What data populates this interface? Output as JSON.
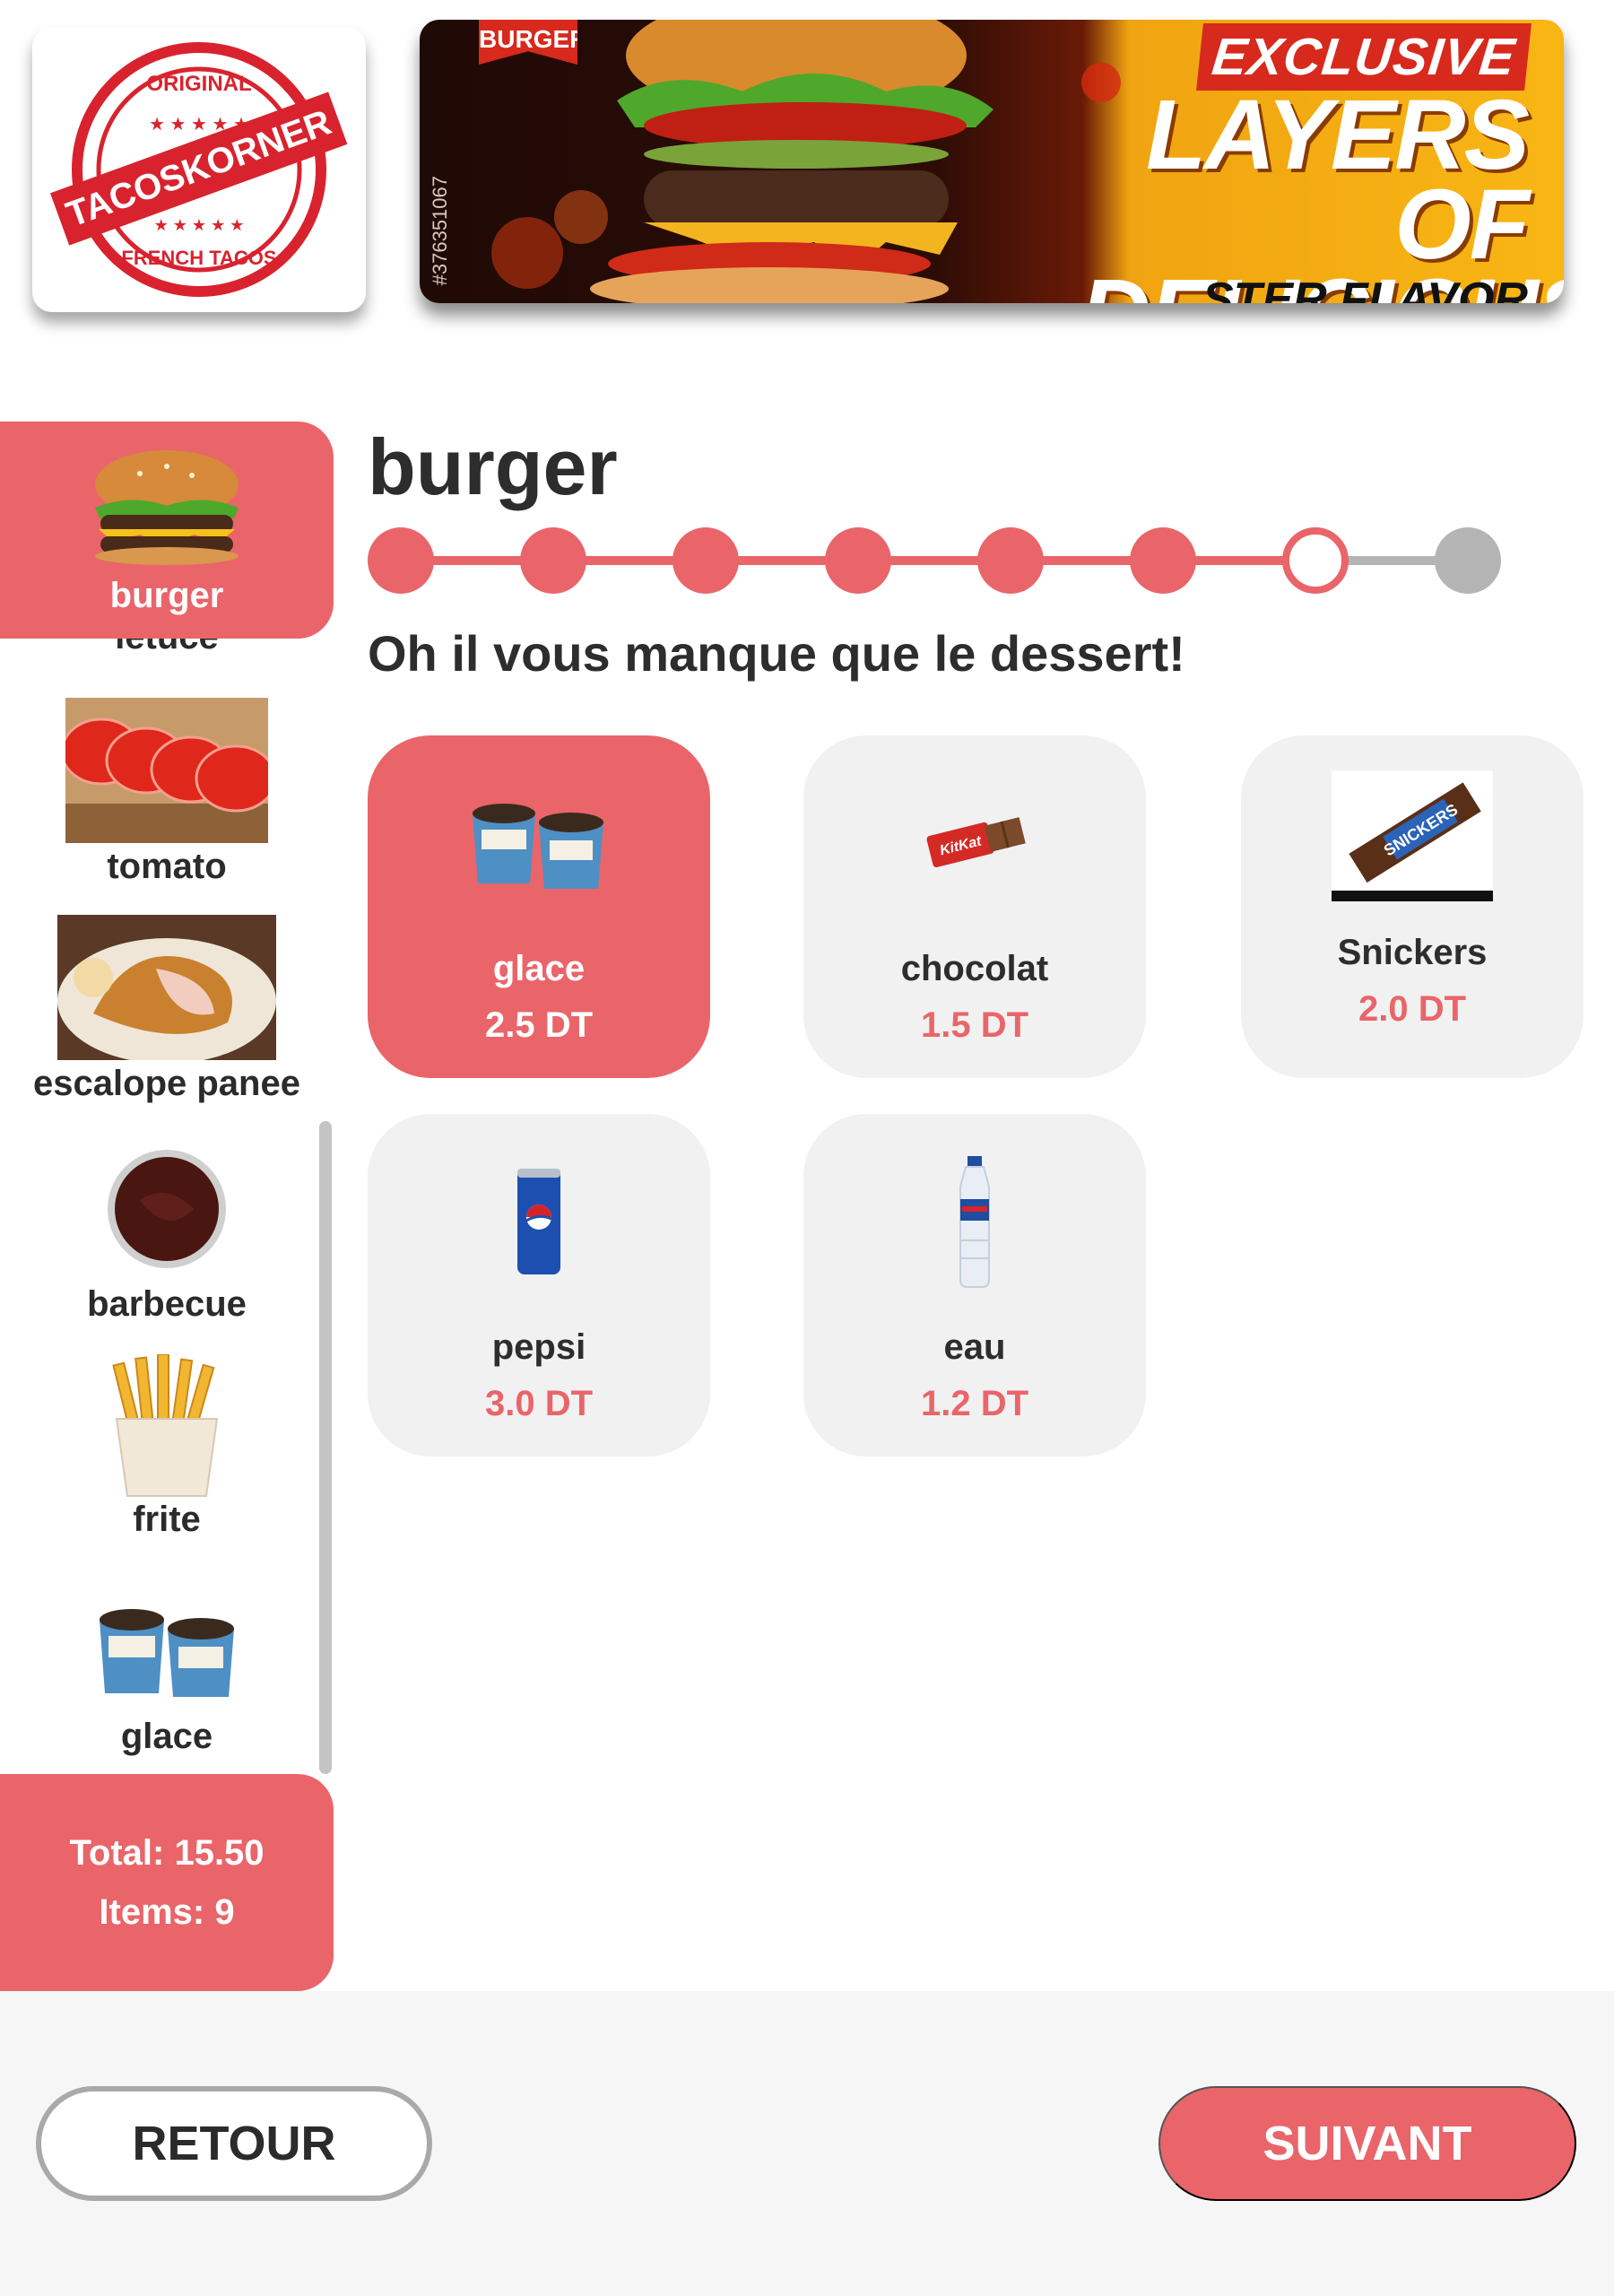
{
  "header": {
    "logo": {
      "brand": "TACOSKORNER",
      "top_text": "ORIGINAL",
      "bottom_text": "FRENCH TACOS"
    },
    "banner": {
      "badge": "BURGER",
      "tag": "EXCLUSIVE",
      "line1": "LAYERS OF",
      "line2": "DELICIOUS",
      "sub": "...STER FLAVOR",
      "stock_id": "#376351067"
    }
  },
  "sidebar": {
    "active": {
      "label": "burger",
      "icon": "burger-icon"
    },
    "items": [
      {
        "label": "letuce",
        "icon": "lettuce-icon"
      },
      {
        "label": "tomato",
        "icon": "tomato-icon"
      },
      {
        "label": "escalope panee",
        "icon": "escalope-icon"
      },
      {
        "label": "barbecue",
        "icon": "barbecue-sauce-icon"
      },
      {
        "label": "frite",
        "icon": "fries-icon"
      },
      {
        "label": "glace",
        "icon": "ice-cream-icon"
      }
    ],
    "total_label": "Total: 15.50",
    "items_label": "Items: 9"
  },
  "main": {
    "title": "burger",
    "stepper": {
      "total_steps": 8,
      "completed": 6,
      "current_index": 7
    },
    "subtitle": "Oh il vous manque que le dessert!",
    "products": [
      {
        "name": "glace",
        "price": "2.5 DT",
        "selected": true,
        "icon": "ice-cream-icon"
      },
      {
        "name": "chocolat",
        "price": "1.5 DT",
        "selected": false,
        "icon": "chocolate-bar-icon"
      },
      {
        "name": "Snickers",
        "price": "2.0 DT",
        "selected": false,
        "icon": "snickers-icon"
      },
      {
        "name": "pepsi",
        "price": "3.0 DT",
        "selected": false,
        "icon": "soda-can-icon"
      },
      {
        "name": "eau",
        "price": "1.2 DT",
        "selected": false,
        "icon": "water-bottle-icon"
      }
    ]
  },
  "footer": {
    "back_label": "RETOUR",
    "next_label": "SUIVANT"
  },
  "colors": {
    "accent": "#e9656a",
    "card_bg": "#f1f1f1",
    "text": "#2d2d2d",
    "future_step": "#b4b4b4"
  }
}
